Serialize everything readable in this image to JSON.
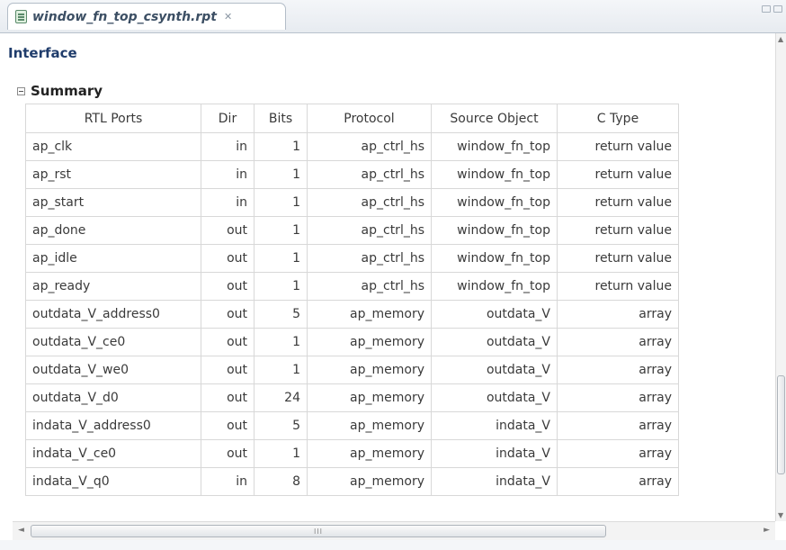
{
  "editor": {
    "tab_title": "window_fn_top_csynth.rpt",
    "close_glyph": "✕",
    "icons": {
      "file": "report-file-icon",
      "close": "close-icon",
      "collapse": "collapse-icon"
    }
  },
  "report": {
    "section_title": "Interface",
    "subsection_title": "Summary",
    "columns": [
      "RTL Ports",
      "Dir",
      "Bits",
      "Protocol",
      "Source Object",
      "C Type"
    ],
    "rows": [
      [
        "ap_clk",
        "in",
        "1",
        "ap_ctrl_hs",
        "window_fn_top",
        "return value"
      ],
      [
        "ap_rst",
        "in",
        "1",
        "ap_ctrl_hs",
        "window_fn_top",
        "return value"
      ],
      [
        "ap_start",
        "in",
        "1",
        "ap_ctrl_hs",
        "window_fn_top",
        "return value"
      ],
      [
        "ap_done",
        "out",
        "1",
        "ap_ctrl_hs",
        "window_fn_top",
        "return value"
      ],
      [
        "ap_idle",
        "out",
        "1",
        "ap_ctrl_hs",
        "window_fn_top",
        "return value"
      ],
      [
        "ap_ready",
        "out",
        "1",
        "ap_ctrl_hs",
        "window_fn_top",
        "return value"
      ],
      [
        "outdata_V_address0",
        "out",
        "5",
        "ap_memory",
        "outdata_V",
        "array"
      ],
      [
        "outdata_V_ce0",
        "out",
        "1",
        "ap_memory",
        "outdata_V",
        "array"
      ],
      [
        "outdata_V_we0",
        "out",
        "1",
        "ap_memory",
        "outdata_V",
        "array"
      ],
      [
        "outdata_V_d0",
        "out",
        "24",
        "ap_memory",
        "outdata_V",
        "array"
      ],
      [
        "indata_V_address0",
        "out",
        "5",
        "ap_memory",
        "indata_V",
        "array"
      ],
      [
        "indata_V_ce0",
        "out",
        "1",
        "ap_memory",
        "indata_V",
        "array"
      ],
      [
        "indata_V_q0",
        "in",
        "8",
        "ap_memory",
        "indata_V",
        "array"
      ]
    ]
  },
  "scrollbars": {
    "horizontal_grip": "III",
    "left_arrow": "◄",
    "right_arrow": "►",
    "up_arrow": "▲",
    "down_arrow": "▼"
  },
  "colors": {
    "section_title": "#1f3c6b",
    "grid_line": "#d8d8d8",
    "tab_border": "#b3bdc8"
  }
}
